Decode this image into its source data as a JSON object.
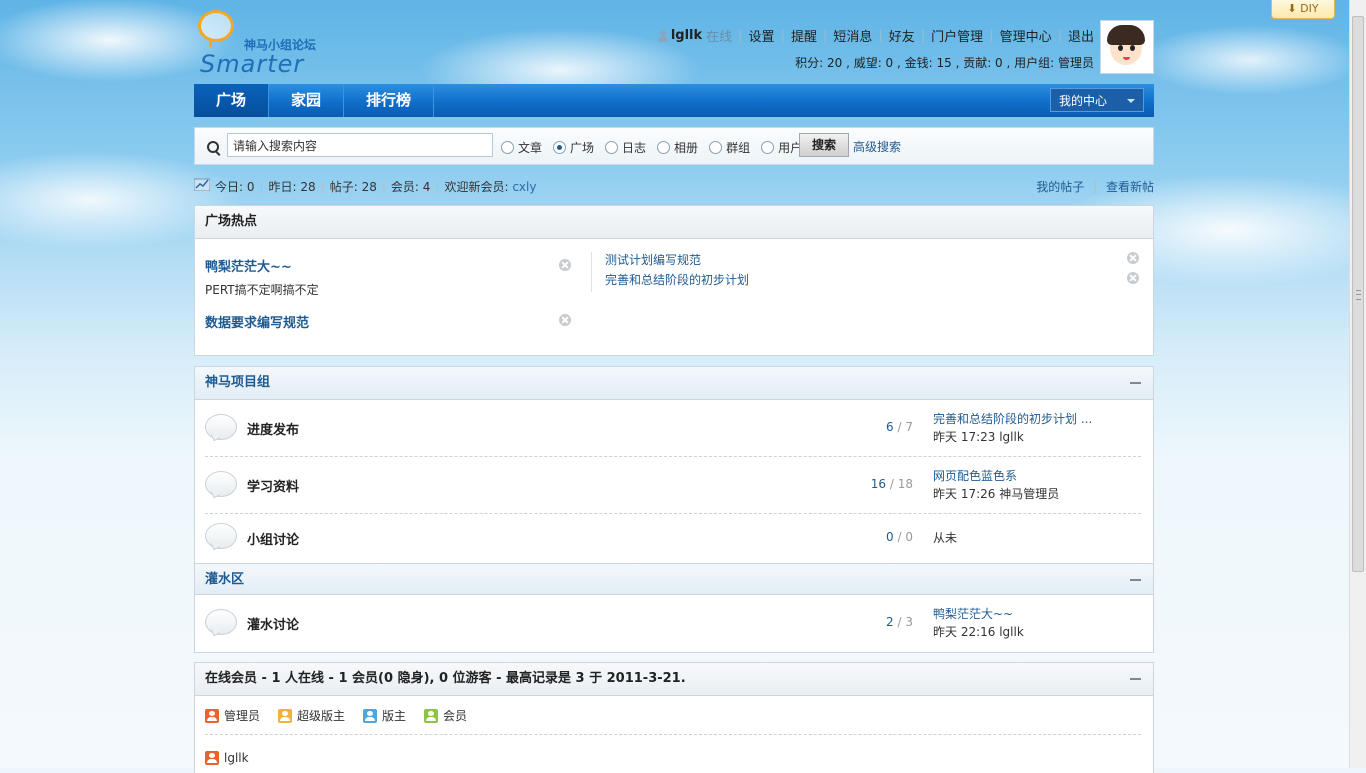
{
  "header": {
    "logo_cn": "神马小组论坛",
    "logo_en": "Smarter",
    "username": "lgllk",
    "status": "在线",
    "links": [
      "设置",
      "提醒",
      "短消息",
      "好友",
      "门户管理",
      "管理中心",
      "退出"
    ],
    "credits": "积分: 20 , 威望: 0 , 金钱: 15 , 贡献: 0 , 用户组: 管理员"
  },
  "diy": "⬇ DIY",
  "nav": {
    "tabs": [
      "广场",
      "家园",
      "排行榜"
    ],
    "my_center": "我的中心"
  },
  "search": {
    "placeholder": "请输入搜索内容",
    "options": [
      "文章",
      "广场",
      "日志",
      "相册",
      "群组",
      "用户"
    ],
    "selected": "广场",
    "button": "搜索",
    "advanced": "高级搜索"
  },
  "stats": {
    "today": "今日: 0",
    "yesterday": "昨日: 28",
    "posts": "帖子: 28",
    "members": "会员: 4",
    "welcome": "欢迎新会员: ",
    "new_member": "cxly",
    "my_posts": "我的帖子",
    "new_posts": "查看新帖"
  },
  "hot": {
    "title": "广场热点",
    "left": [
      {
        "title": "鸭梨茫茫大~~",
        "sub": "PERT搞不定啊搞不定"
      },
      {
        "title": "数据要求编写规范",
        "sub": ""
      }
    ],
    "right": [
      "测试计划编写规范",
      "完善和总结阶段的初步计划"
    ]
  },
  "group1": {
    "title": "神马项目组",
    "forums": [
      {
        "name": "进度发布",
        "threads": "6",
        "posts": "7",
        "last_title": "完善和总结阶段的初步计划 ...",
        "last_meta": "昨天 17:23 lgllk"
      },
      {
        "name": "学习资料",
        "threads": "16",
        "posts": "18",
        "last_title": "网页配色蓝色系",
        "last_meta": "昨天 17:26 神马管理员"
      },
      {
        "name": "小组讨论",
        "threads": "0",
        "posts": "0",
        "last_title": "从未",
        "last_meta": ""
      }
    ]
  },
  "group2": {
    "title": "灌水区",
    "forums": [
      {
        "name": "灌水讨论",
        "threads": "2",
        "posts": "3",
        "last_title": "鸭梨茫茫大~~",
        "last_meta": "昨天 22:16 lgllk"
      }
    ]
  },
  "online": {
    "title": "在线会员",
    "summary": " - 1 人在线 - 1 会员(0 隐身), 0 位游客 - 最高记录是 3 于 2011-3-21.",
    "legend": [
      "管理员",
      "超级版主",
      "版主",
      "会员"
    ],
    "users": [
      "lgllk"
    ]
  },
  "colors": {
    "nav_blue": "#0e6cc8",
    "link_blue": "#1e5b92",
    "accent_orange": "#f5a623"
  }
}
